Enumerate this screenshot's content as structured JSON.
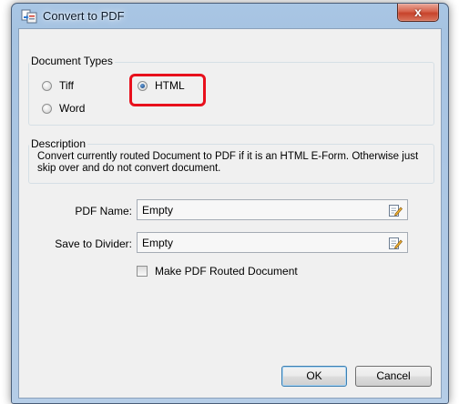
{
  "window": {
    "title": "Convert to PDF",
    "close_glyph": "x"
  },
  "document_types": {
    "legend": "Document Types",
    "options": [
      {
        "label": "Tiff",
        "checked": false
      },
      {
        "label": "HTML",
        "checked": true
      },
      {
        "label": "Word",
        "checked": false
      }
    ]
  },
  "description": {
    "legend": "Description",
    "text": "Convert currently routed Document to PDF if it is an HTML E-Form.  Otherwise just skip over and do not convert document."
  },
  "fields": {
    "pdf_name": {
      "label": "PDF Name:",
      "value": "Empty"
    },
    "save_to_divider": {
      "label": "Save to Divider:",
      "value": "Empty"
    }
  },
  "make_pdf_routed": {
    "label": "Make PDF Routed Document",
    "checked": false
  },
  "buttons": {
    "ok": "OK",
    "cancel": "Cancel"
  },
  "colors": {
    "highlight": "#e8101c",
    "title_bar": "#a9c6e4",
    "close_button": "#c7432b"
  },
  "icons": {
    "app": "convert-pdf-icon",
    "field_edit": "edit-pencil-icon"
  }
}
